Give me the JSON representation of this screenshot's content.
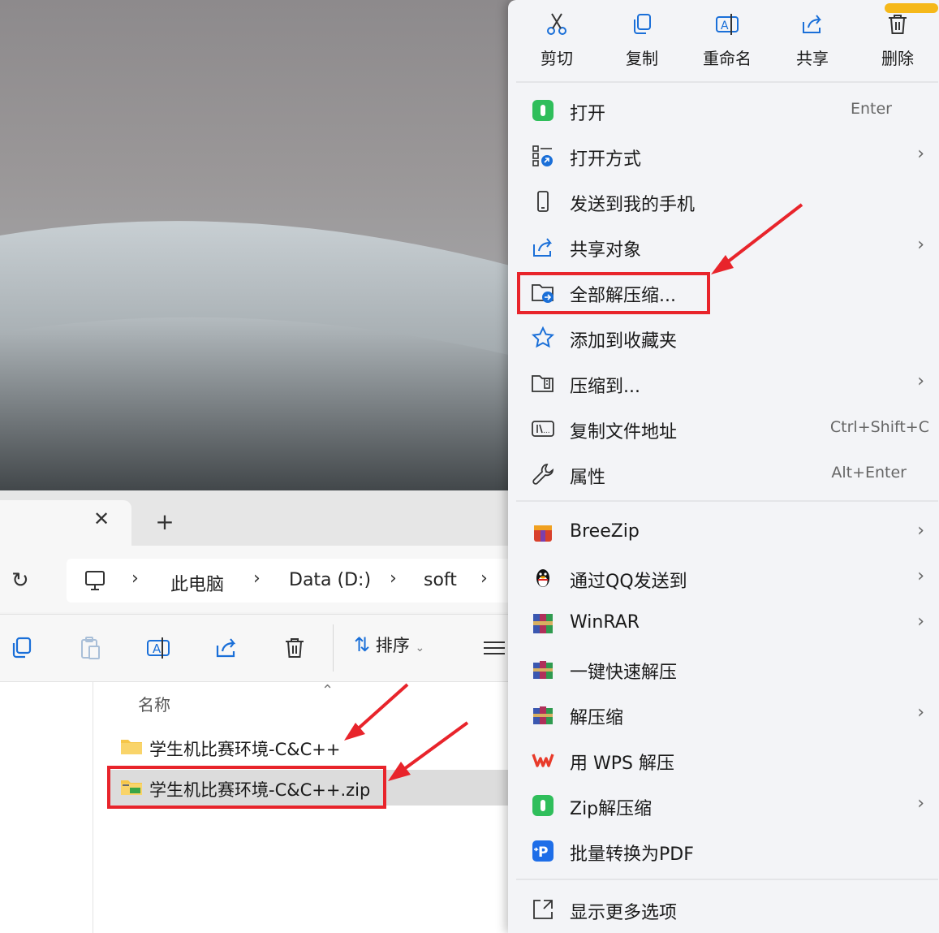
{
  "explorer": {
    "tab_close": "✕",
    "tab_add": "+",
    "breadcrumbs": [
      "此电脑",
      "Data (D:)",
      "soft"
    ],
    "separator": "›",
    "sort_label": "排序",
    "column_header": "名称",
    "files": [
      {
        "name": "学生机比赛环境-C&C++",
        "type": "folder"
      },
      {
        "name": "学生机比赛环境-C&C++.zip",
        "type": "zip",
        "selected": true
      }
    ]
  },
  "context_menu": {
    "quick_actions": [
      {
        "label": "剪切",
        "icon": "scissors-icon"
      },
      {
        "label": "复制",
        "icon": "copy-icon"
      },
      {
        "label": "重命名",
        "icon": "rename-icon"
      },
      {
        "label": "共享",
        "icon": "share-icon"
      },
      {
        "label": "删除",
        "icon": "trash-icon"
      }
    ],
    "items": [
      {
        "label": "打开",
        "shortcut": "Enter",
        "icon": "zip-app-icon"
      },
      {
        "label": "打开方式",
        "submenu": true,
        "icon": "open-with-icon"
      },
      {
        "label": "发送到我的手机",
        "icon": "phone-icon"
      },
      {
        "label": "共享对象",
        "submenu": true,
        "icon": "share-icon"
      },
      {
        "label": "全部解压缩...",
        "icon": "extract-all-icon",
        "highlighted": true
      },
      {
        "label": "添加到收藏夹",
        "icon": "star-icon"
      },
      {
        "label": "压缩到...",
        "submenu": true,
        "icon": "compress-icon"
      },
      {
        "label": "复制文件地址",
        "shortcut": "Ctrl+Shift+C",
        "icon": "copy-path-icon"
      },
      {
        "label": "属性",
        "shortcut": "Alt+Enter",
        "icon": "wrench-icon"
      },
      {
        "label": "BreeZip",
        "submenu": true,
        "icon": "breezip-icon"
      },
      {
        "label": "通过QQ发送到",
        "submenu": true,
        "icon": "qq-penguin-icon"
      },
      {
        "label": "WinRAR",
        "submenu": true,
        "icon": "winrar-icon"
      },
      {
        "label": "一键快速解压",
        "icon": "winrar-books-icon"
      },
      {
        "label": "解压缩",
        "submenu": true,
        "icon": "winrar-books-icon"
      },
      {
        "label": "用 WPS 解压",
        "icon": "wps-icon"
      },
      {
        "label": "Zip解压缩",
        "submenu": true,
        "icon": "zip-app-icon"
      },
      {
        "label": "批量转换为PDF",
        "icon": "pdf-convert-icon"
      },
      {
        "label": "显示更多选项",
        "icon": "more-options-icon"
      }
    ],
    "submenu_arrow": "›"
  },
  "colors": {
    "highlight_red": "#e8242b",
    "menu_bg": "#f3f4f7",
    "accent_blue": "#1a6fd8"
  }
}
